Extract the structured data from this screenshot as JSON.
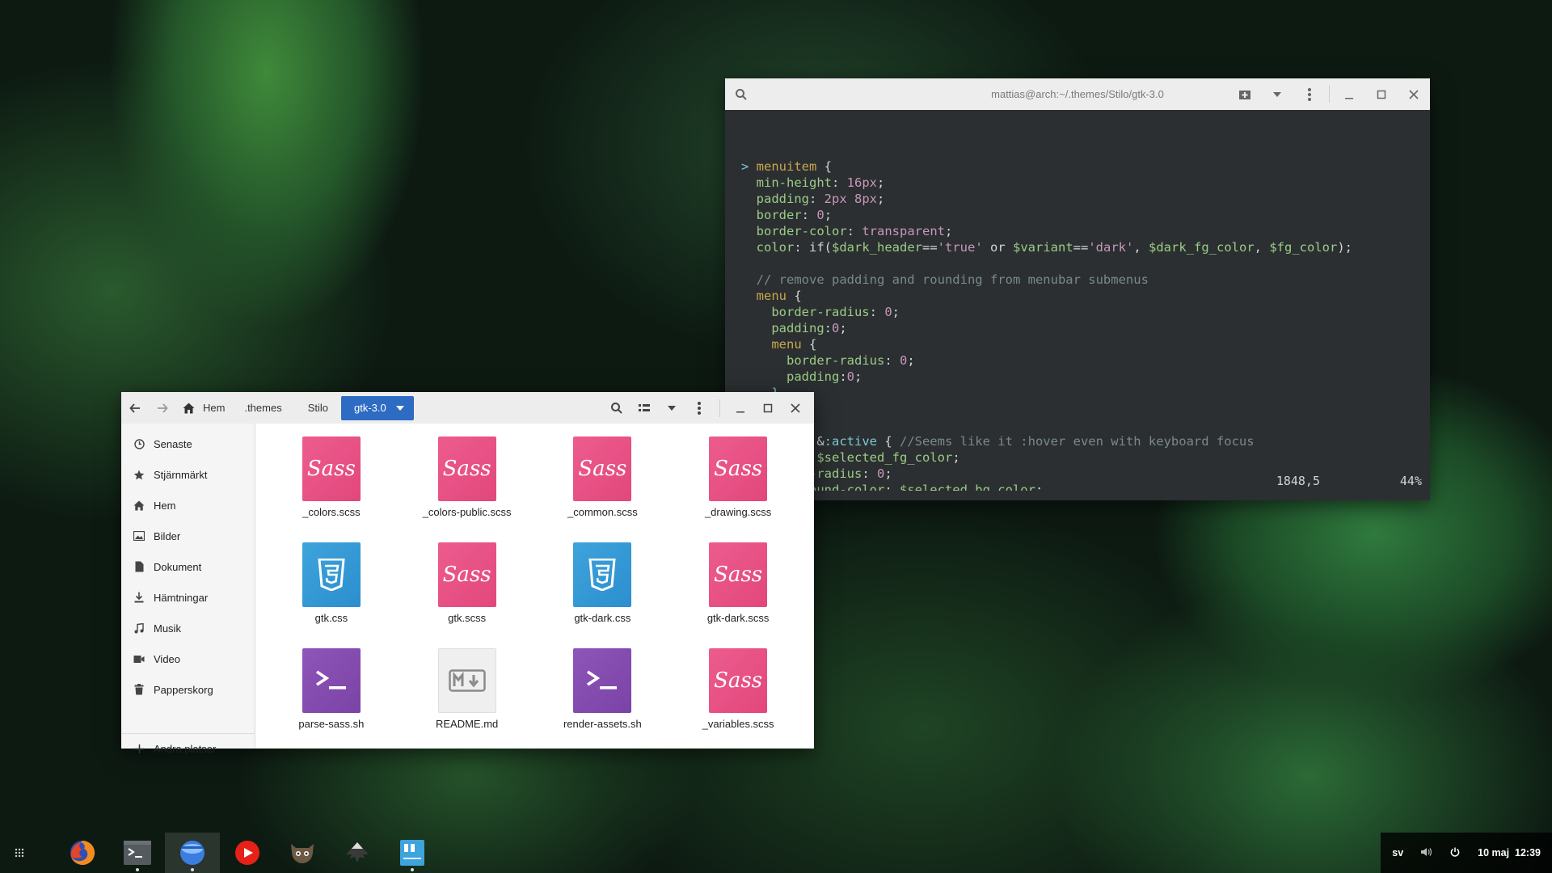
{
  "terminal": {
    "title": "mattias@arch:~/.themes/Stilo/gtk-3.0",
    "status_position": "1848,5",
    "status_percent": "44%",
    "icons": {
      "search": "search-icon",
      "new_tab": "new-tab-icon",
      "menu_dropdown": "chevron-down-icon",
      "more": "more-vertical-icon",
      "minimize": "minimize-icon",
      "maximize": "maximize-icon",
      "close": "close-icon"
    },
    "lines": [
      [
        {
          "t": "> ",
          "c": "ps"
        },
        {
          "t": "menuitem",
          "c": "k"
        },
        {
          "t": " {",
          "c": ""
        }
      ],
      [
        {
          "t": "  ",
          "c": ""
        },
        {
          "t": "min-height",
          "c": "p"
        },
        {
          "t": ": ",
          "c": ""
        },
        {
          "t": "16px",
          "c": "v"
        },
        {
          "t": ";",
          "c": ""
        }
      ],
      [
        {
          "t": "  ",
          "c": ""
        },
        {
          "t": "padding",
          "c": "p"
        },
        {
          "t": ": ",
          "c": ""
        },
        {
          "t": "2px 8px",
          "c": "v"
        },
        {
          "t": ";",
          "c": ""
        }
      ],
      [
        {
          "t": "  ",
          "c": ""
        },
        {
          "t": "border",
          "c": "p"
        },
        {
          "t": ": ",
          "c": ""
        },
        {
          "t": "0",
          "c": "v"
        },
        {
          "t": ";",
          "c": ""
        }
      ],
      [
        {
          "t": "  ",
          "c": ""
        },
        {
          "t": "border-color",
          "c": "p"
        },
        {
          "t": ": ",
          "c": ""
        },
        {
          "t": "transparent",
          "c": "v"
        },
        {
          "t": ";",
          "c": ""
        }
      ],
      [
        {
          "t": "  ",
          "c": ""
        },
        {
          "t": "color",
          "c": "p"
        },
        {
          "t": ": if(",
          "c": ""
        },
        {
          "t": "$dark_header",
          "c": "d"
        },
        {
          "t": "==",
          "c": ""
        },
        {
          "t": "'true'",
          "c": "v"
        },
        {
          "t": " or ",
          "c": ""
        },
        {
          "t": "$variant",
          "c": "d"
        },
        {
          "t": "==",
          "c": ""
        },
        {
          "t": "'dark'",
          "c": "v"
        },
        {
          "t": ", ",
          "c": ""
        },
        {
          "t": "$dark_fg_color",
          "c": "d"
        },
        {
          "t": ", ",
          "c": ""
        },
        {
          "t": "$fg_color",
          "c": "d"
        },
        {
          "t": ");",
          "c": ""
        }
      ],
      [
        {
          "t": "",
          "c": ""
        }
      ],
      [
        {
          "t": "  ",
          "c": ""
        },
        {
          "t": "// remove padding and rounding from menubar submenus",
          "c": "c"
        }
      ],
      [
        {
          "t": "  ",
          "c": ""
        },
        {
          "t": "menu",
          "c": "k"
        },
        {
          "t": " {",
          "c": ""
        }
      ],
      [
        {
          "t": "    ",
          "c": ""
        },
        {
          "t": "border-radius",
          "c": "p"
        },
        {
          "t": ": ",
          "c": ""
        },
        {
          "t": "0",
          "c": "v"
        },
        {
          "t": ";",
          "c": ""
        }
      ],
      [
        {
          "t": "    ",
          "c": ""
        },
        {
          "t": "padding",
          "c": "p"
        },
        {
          "t": ":",
          "c": ""
        },
        {
          "t": "0",
          "c": "v"
        },
        {
          "t": ";",
          "c": ""
        }
      ],
      [
        {
          "t": "    ",
          "c": ""
        },
        {
          "t": "menu",
          "c": "k"
        },
        {
          "t": " {",
          "c": ""
        }
      ],
      [
        {
          "t": "      ",
          "c": ""
        },
        {
          "t": "border-radius",
          "c": "p"
        },
        {
          "t": ": ",
          "c": ""
        },
        {
          "t": "0",
          "c": "v"
        },
        {
          "t": ";",
          "c": ""
        }
      ],
      [
        {
          "t": "      ",
          "c": ""
        },
        {
          "t": "padding",
          "c": "p"
        },
        {
          "t": ":",
          "c": ""
        },
        {
          "t": "0",
          "c": "v"
        },
        {
          "t": ";",
          "c": ""
        }
      ],
      [
        {
          "t": "    }",
          "c": "ps"
        }
      ],
      [
        {
          "t": "  }",
          "c": "ps"
        }
      ],
      [
        {
          "t": "",
          "c": ""
        }
      ],
      [
        {
          "t": "        , &",
          "c": ""
        },
        {
          "t": ":active",
          "c": "ps"
        },
        {
          "t": " { ",
          "c": ""
        },
        {
          "t": "//Seems like it :hover even with keyboard focus",
          "c": "c"
        }
      ],
      [
        {
          "t": "        ",
          "c": ""
        },
        {
          "t": ": ",
          "c": ""
        },
        {
          "t": "$selected_fg_color",
          "c": "d"
        },
        {
          "t": ";",
          "c": ""
        }
      ],
      [
        {
          "t": "        ",
          "c": ""
        },
        {
          "t": "r-radius",
          "c": "p"
        },
        {
          "t": ": ",
          "c": ""
        },
        {
          "t": "0",
          "c": "v"
        },
        {
          "t": ";",
          "c": ""
        }
      ],
      [
        {
          "t": "        ",
          "c": ""
        },
        {
          "t": "round-color",
          "c": "p"
        },
        {
          "t": ": ",
          "c": ""
        },
        {
          "t": "$selected_bg_color",
          "c": "d"
        },
        {
          "t": ";",
          "c": ""
        }
      ]
    ]
  },
  "files": {
    "breadcrumbs": [
      "Hem",
      ".themes",
      "Stilo",
      "gtk-3.0"
    ],
    "sidebar": [
      {
        "label": "Senaste",
        "icon": "clock-icon"
      },
      {
        "label": "Stjärnmärkt",
        "icon": "star-icon"
      },
      {
        "label": "Hem",
        "icon": "home-icon"
      },
      {
        "label": "Bilder",
        "icon": "image-icon"
      },
      {
        "label": "Dokument",
        "icon": "document-icon"
      },
      {
        "label": "Hämtningar",
        "icon": "download-icon"
      },
      {
        "label": "Musik",
        "icon": "music-icon"
      },
      {
        "label": "Video",
        "icon": "video-icon"
      },
      {
        "label": "Papperskorg",
        "icon": "trash-icon"
      }
    ],
    "other_places": "Andra platser",
    "items": [
      {
        "name": "_colors.scss",
        "type": "sass"
      },
      {
        "name": "_colors-public.scss",
        "type": "sass"
      },
      {
        "name": "_common.scss",
        "type": "sass"
      },
      {
        "name": "_drawing.scss",
        "type": "sass"
      },
      {
        "name": "gtk.css",
        "type": "css"
      },
      {
        "name": "gtk.scss",
        "type": "sass"
      },
      {
        "name": "gtk-dark.css",
        "type": "css"
      },
      {
        "name": "gtk-dark.scss",
        "type": "sass"
      },
      {
        "name": "parse-sass.sh",
        "type": "sh"
      },
      {
        "name": "README.md",
        "type": "md"
      },
      {
        "name": "render-assets.sh",
        "type": "sh"
      },
      {
        "name": "_variables.scss",
        "type": "sass"
      }
    ],
    "sass_glyph": "Sass"
  },
  "taskbar": {
    "apps": [
      "firefox-icon",
      "terminal-icon",
      "files-icon",
      "youtube-icon",
      "gimp-icon",
      "inkscape-icon",
      "text-editor-icon"
    ],
    "lang": "sv",
    "clock": "10 maj  12:39"
  },
  "colors": {
    "accent": "#2e6bc3",
    "sass": "#e2477c",
    "css": "#2c8ecf",
    "sh": "#7a43a6"
  }
}
